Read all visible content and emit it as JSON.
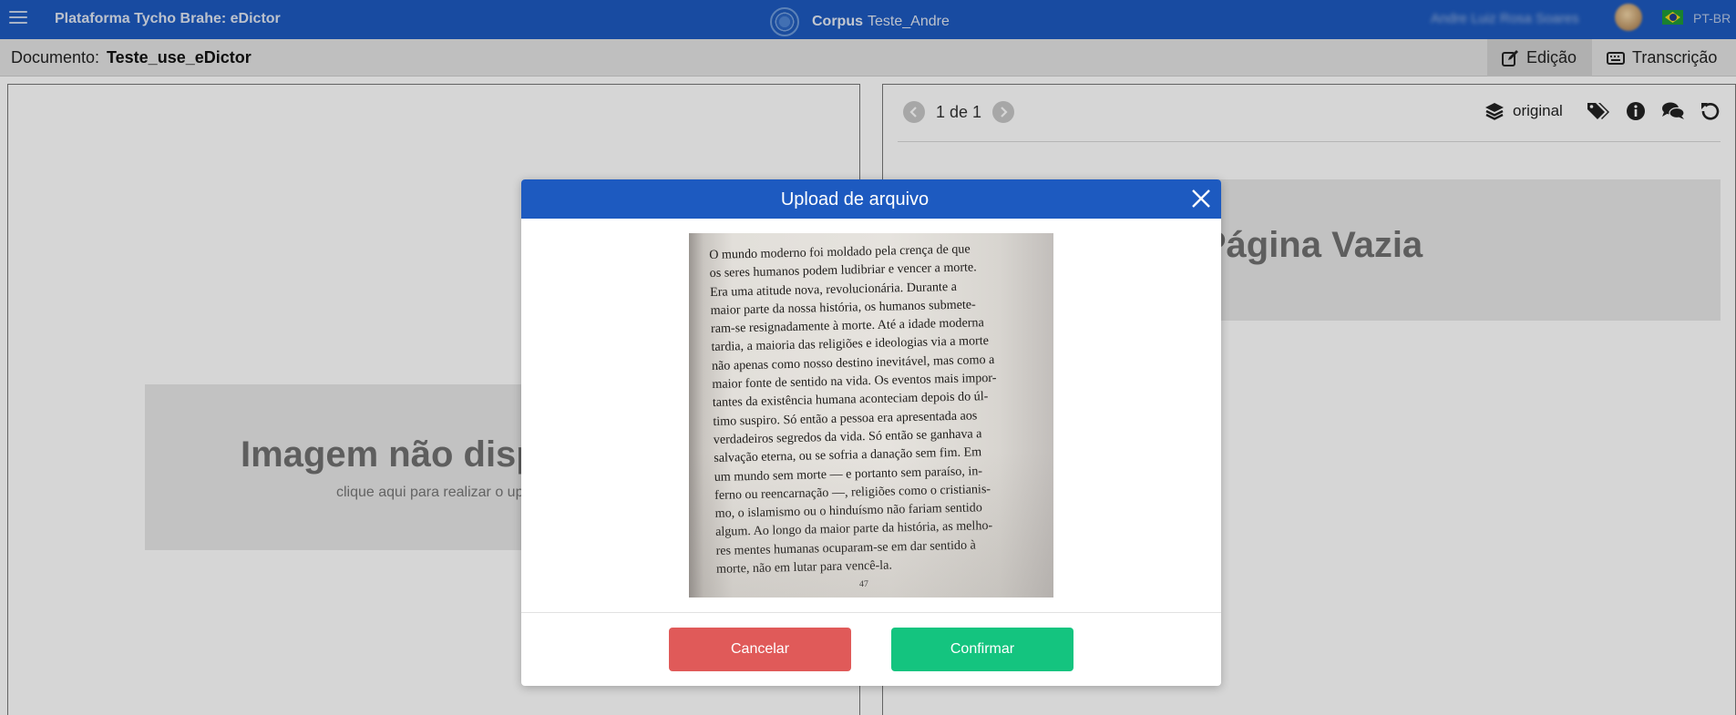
{
  "header": {
    "app_title": "Plataforma Tycho Brahe: eDictor",
    "corpus_label": "Corpus",
    "corpus_name": "Teste_Andre",
    "user_name": "Andre Luiz Rosa Soares",
    "language": "PT-BR"
  },
  "document_bar": {
    "label": "Documento:",
    "name": "Teste_use_eDictor",
    "tabs": [
      {
        "label": "Edição",
        "icon": "edit-icon",
        "active": true
      },
      {
        "label": "Transcrição",
        "icon": "keyboard-icon",
        "active": false
      }
    ]
  },
  "left_panel": {
    "placeholder_title": "Imagem não disponível",
    "placeholder_subtitle": "clique aqui para realizar o upload"
  },
  "right_panel": {
    "pager_text": "1 de 1",
    "version_label": "original",
    "placeholder_title": "Página Vazia",
    "tool_icons": [
      "tags-icon",
      "info-icon",
      "comments-icon",
      "undo-icon"
    ]
  },
  "modal": {
    "title": "Upload de arquivo",
    "cancel_label": "Cancelar",
    "confirm_label": "Confirmar",
    "image_lines": [
      "O mundo moderno foi moldado pela crença de que",
      "os seres humanos podem ludibriar e vencer a morte.",
      "Era uma atitude nova, revolucionária. Durante a",
      "maior parte da nossa história, os humanos submete-",
      "ram-se resignadamente à morte. Até a idade moderna",
      "tardia, a maioria das religiões e ideologias via a morte",
      "não apenas como nosso destino inevitável, mas como a",
      "maior fonte de sentido na vida. Os eventos mais impor-",
      "tantes da existência humana aconteciam depois do úl-",
      "timo suspiro. Só então a pessoa era apresentada aos",
      "verdadeiros segredos da vida. Só então se ganhava a",
      "salvação eterna, ou se sofria a danação sem fim. Em",
      "um mundo sem morte — e portanto sem paraíso, in-",
      "ferno ou reencarnação —, religiões como o cristianis-",
      "mo, o islamismo ou o hinduísmo não fariam sentido",
      "algum. Ao longo da maior parte da história, as melho-",
      "res mentes humanas ocuparam-se em dar sentido à",
      "morte, não em lutar para vencê-la."
    ],
    "image_page_number": "47"
  },
  "colors": {
    "brand_blue": "#1d5ac0",
    "cancel_red": "#e05a59",
    "confirm_green": "#14c47f"
  }
}
